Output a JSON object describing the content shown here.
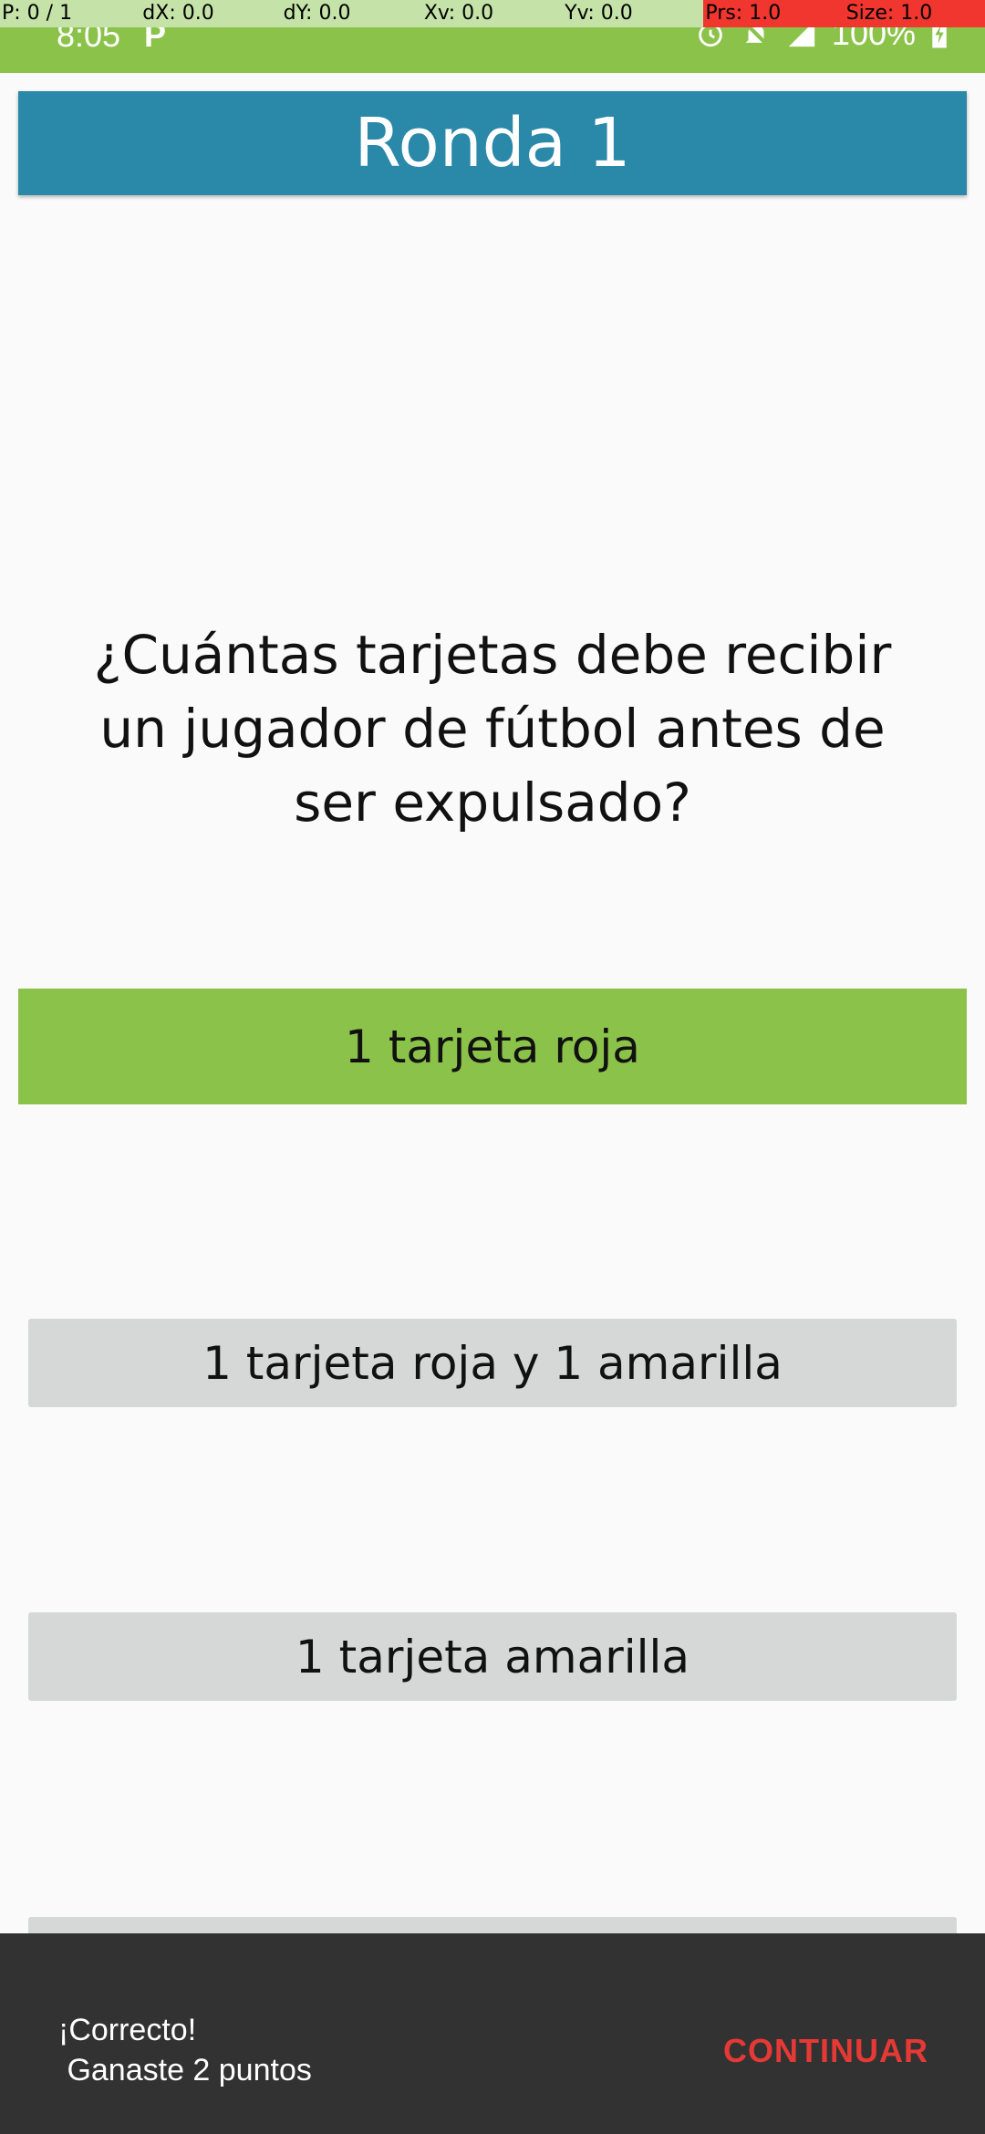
{
  "debug_overlay": {
    "pointer": "P: 0 / 1",
    "dx": "dX: 0.0",
    "dy": "dY: 0.0",
    "xv": "Xv: 0.0",
    "yv": "Yv: 0.0",
    "prs": "Prs: 1.0",
    "size": "Size: 1.0"
  },
  "status_bar": {
    "time": "8:05",
    "battery": "100%",
    "icons": [
      "parking-icon",
      "alarm-icon",
      "bell-off-icon",
      "signal-icon",
      "battery-charging-icon"
    ]
  },
  "header": {
    "title": "Ronda 1"
  },
  "question": {
    "text": "¿Cuántas tarjetas debe recibir un jugador de fútbol antes de ser expulsado?"
  },
  "answers": [
    {
      "label": "1 tarjeta roja",
      "state": "correct"
    },
    {
      "label": "1 tarjeta roja y 1 amarilla",
      "state": "neutral"
    },
    {
      "label": "1 tarjeta amarilla",
      "state": "neutral"
    }
  ],
  "snackbar": {
    "message": "¡Correcto!\n Ganaste 2 puntos",
    "action": "CONTINUAR"
  },
  "colors": {
    "status_bar": "#8bc34a",
    "header": "#2a88a8",
    "correct_answer": "#8bc34a",
    "neutral_answer": "#d6d7d7",
    "snackbar_bg": "#323232",
    "snackbar_action": "#e53935"
  }
}
